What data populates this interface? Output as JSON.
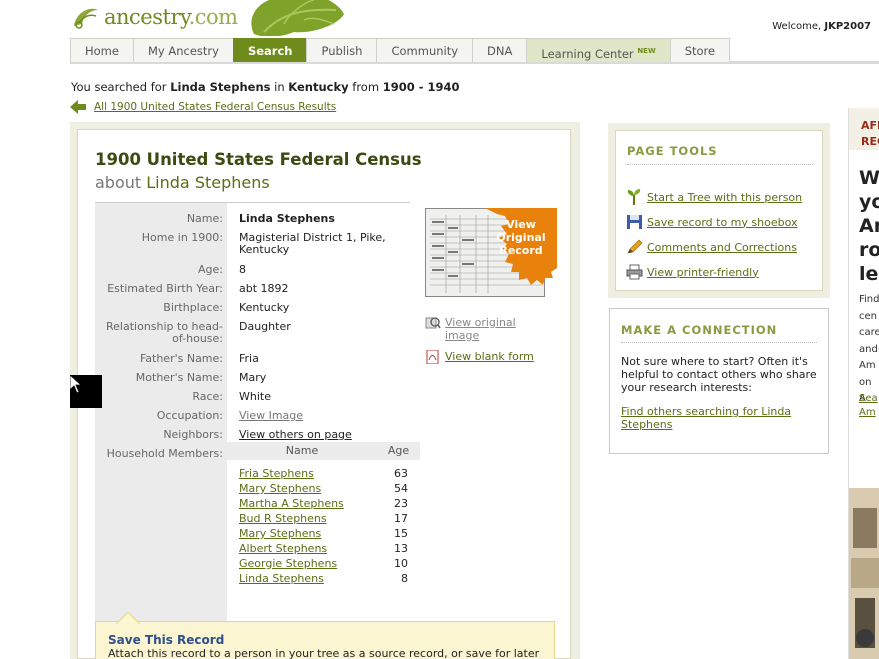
{
  "header": {
    "logo_text": "ancestry",
    "logo_suffix": ".com",
    "welcome_prefix": "Welcome,",
    "username": "JKP2007"
  },
  "nav": {
    "tabs": [
      {
        "label": "Home",
        "active": false
      },
      {
        "label": "My Ancestry",
        "active": false
      },
      {
        "label": "Search",
        "active": true
      },
      {
        "label": "Publish",
        "active": false
      },
      {
        "label": "Community",
        "active": false
      },
      {
        "label": "DNA",
        "active": false
      },
      {
        "label": "Learning Center",
        "badge": "NEW",
        "active": false
      },
      {
        "label": "Store",
        "active": false
      }
    ]
  },
  "search_summary": {
    "prefix": "You searched for",
    "name": "Linda Stephens",
    "in_word": "in",
    "place": "Kentucky",
    "from_word": "from",
    "range": "1900 - 1940"
  },
  "back_link": "All 1900 United States Federal Census Results",
  "record": {
    "title": "1900 United States Federal Census",
    "about_prefix": "about",
    "about_name": "Linda Stephens",
    "fields": [
      {
        "label": "Name:",
        "value": "Linda Stephens"
      },
      {
        "label": "Home in 1900:",
        "value": "Magisterial District 1, Pike, Kentucky"
      },
      {
        "label": "Age:",
        "value": "8"
      },
      {
        "label": "Estimated Birth Year:",
        "value": "abt 1892"
      },
      {
        "label": "Birthplace:",
        "value": "Kentucky"
      },
      {
        "label": "Relationship to head-of-house:",
        "value": "Daughter"
      },
      {
        "label": "Father's Name:",
        "value": "Fria"
      },
      {
        "label": "Mother's Name:",
        "value": "Mary"
      },
      {
        "label": "Race:",
        "value": "White"
      },
      {
        "label": "Occupation:",
        "value": "View Image"
      },
      {
        "label": "Neighbors:",
        "value": "View others on page"
      },
      {
        "label": "Household Members:",
        "value": ""
      }
    ],
    "household": {
      "col_name": "Name",
      "col_age": "Age",
      "members": [
        {
          "name": "Fria Stephens",
          "age": "63"
        },
        {
          "name": "Mary Stephens",
          "age": "54"
        },
        {
          "name": "Martha A Stephens",
          "age": "23"
        },
        {
          "name": "Bud R Stephens",
          "age": "17"
        },
        {
          "name": "Mary Stephens",
          "age": "15"
        },
        {
          "name": "Albert Stephens",
          "age": "13"
        },
        {
          "name": "Georgie Stephens",
          "age": "10"
        },
        {
          "name": "Linda Stephens",
          "age": "8"
        }
      ]
    },
    "badge_text": "View Original Record",
    "view_original_link": "View original image",
    "view_blank_link": "View blank form",
    "save_title": "Save This Record",
    "save_desc": "Attach this record to a person in your tree as a source record, or save for later evaluation"
  },
  "page_tools": {
    "heading": "PAGE TOOLS",
    "items": [
      {
        "label": "Start a Tree with this person",
        "icon": "tree-sprout-icon"
      },
      {
        "label": "Save record to my shoebox",
        "icon": "floppy-disk-icon"
      },
      {
        "label": "Comments and Corrections",
        "icon": "pencil-icon"
      },
      {
        "label": "View printer-friendly",
        "icon": "printer-icon"
      }
    ]
  },
  "connect": {
    "heading": "MAKE A CONNECTION",
    "text": "Not sure where to start? Often it's helpful to contact others who share your research interests:",
    "link": "Find others searching for Linda Stephens"
  },
  "colors": {
    "brand_green": "#6f8b1b",
    "link_green": "#5a6e14",
    "badge_orange": "#e8820c",
    "save_blue": "#2e4f8c"
  }
}
